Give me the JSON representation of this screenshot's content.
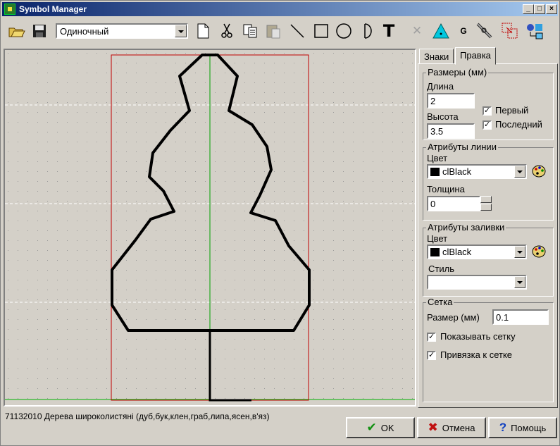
{
  "window": {
    "title": "Symbol Manager"
  },
  "toolbar": {
    "mode_value": "Одиночный",
    "buttons": [
      "open-icon",
      "save-icon",
      "new-icon",
      "cut-icon",
      "copy-icon",
      "paste-icon",
      "line-icon",
      "rectangle-icon",
      "circle-icon",
      "arc-icon",
      "text-icon",
      "delete-icon",
      "triangle-icon",
      "g-icon",
      "pen-tool-icon",
      "transform-icon",
      "layers-icon"
    ],
    "text_tool_label": "T",
    "g_label": "G"
  },
  "tabs": [
    "Знаки",
    "Правка"
  ],
  "sizes": {
    "title": "Размеры (мм)",
    "length_label": "Длина",
    "length_value": "2",
    "height_label": "Высота",
    "height_value": "3.5",
    "first_label": "Первый",
    "last_label": "Последний"
  },
  "line_attrs": {
    "title": "Атрибуты линии",
    "color_label": "Цвет",
    "color_value": "clBlack",
    "thickness_label": "Толщина",
    "thickness_value": "0"
  },
  "fill_attrs": {
    "title": "Атрибуты заливки",
    "color_label": "Цвет",
    "color_value": "clBlack",
    "style_label": "Стиль",
    "style_value": ""
  },
  "grid": {
    "title": "Сетка",
    "size_label": "Размер (мм)",
    "size_value": "0.1",
    "show_label": "Показывать сетку",
    "snap_label": "Привязка к сетке"
  },
  "status_text": "71132010 Дерева широколистяні (дуб,бук,клен,граб,липа,ясен,в'яз)",
  "buttons": {
    "ok": "OK",
    "cancel": "Отмена",
    "help": "Помощь"
  },
  "colors": {
    "frame": "#c00000",
    "axis": "#00a000",
    "grid_line": "#ffffff",
    "title_start": "#0a246a",
    "title_end": "#a6caf0"
  }
}
